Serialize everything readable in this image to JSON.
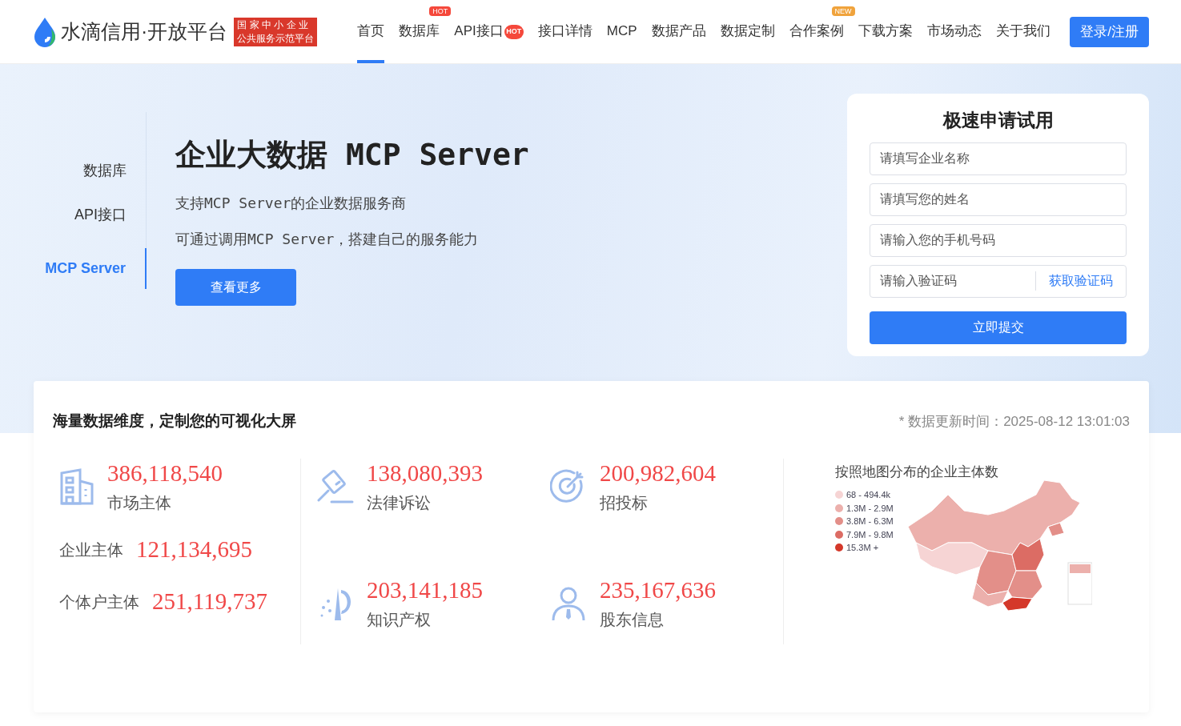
{
  "header": {
    "logo_text": "水滴信用·开放平台",
    "badge_lines": [
      "国 家 中 小 企 业",
      "公共服务示范平台"
    ],
    "nav": [
      {
        "label": "首页",
        "selected": true
      },
      {
        "label": "数据库",
        "selected": false,
        "tag": {
          "kind": "tab",
          "text": "HOT",
          "color": "#f5483b"
        }
      },
      {
        "label": "API接口",
        "selected": false,
        "tag": {
          "kind": "flame",
          "text": "HOT",
          "color": "#f5483b"
        }
      },
      {
        "label": "接口详情",
        "selected": false
      },
      {
        "label": "MCP",
        "selected": false
      },
      {
        "label": "数据产品",
        "selected": false
      },
      {
        "label": "数据定制",
        "selected": false
      },
      {
        "label": "合作案例",
        "selected": false,
        "tag": {
          "kind": "tab",
          "text": "NEW",
          "color": "#f0a33c"
        }
      },
      {
        "label": "下载方案",
        "selected": false
      },
      {
        "label": "市场动态",
        "selected": false
      },
      {
        "label": "关于我们",
        "selected": false
      }
    ],
    "login_button": "登录/注册"
  },
  "hero": {
    "side_tabs": [
      {
        "label": "数据库",
        "selected": false
      },
      {
        "label": "API接口",
        "selected": false
      },
      {
        "label": "MCP Server",
        "selected": true
      }
    ],
    "title": "企业大数据 MCP Server",
    "lines": [
      "支持MCP Server的企业数据服务商",
      "可通过调用MCP Server，搭建自己的服务能力"
    ],
    "more_button": "查看更多"
  },
  "trial_form": {
    "title": "极速申请试用",
    "fields": [
      {
        "placeholder": "请填写企业名称"
      },
      {
        "placeholder": "请填写您的姓名"
      },
      {
        "placeholder": "请输入您的手机号码"
      }
    ],
    "code_field": {
      "placeholder": "请输入验证码",
      "action": "获取验证码"
    },
    "submit": "立即提交"
  },
  "stats": {
    "title": "海量数据维度，定制您的可视化大屏",
    "update_label": "* 数据更新时间：",
    "update_time": "2025-08-12 13:01:03",
    "market": {
      "value": "386,118,540",
      "label": "市场主体",
      "sub": [
        {
          "label": "企业主体",
          "value": "121,134,695"
        },
        {
          "label": "个体户主体",
          "value": "251,119,737"
        }
      ]
    },
    "items": [
      {
        "kind": "law",
        "value": "138,080,393",
        "label": "法律诉讼"
      },
      {
        "kind": "bid",
        "value": "200,982,604",
        "label": "招投标"
      },
      {
        "kind": "ip",
        "value": "203,141,185",
        "label": "知识产权"
      },
      {
        "kind": "holder",
        "value": "235,167,636",
        "label": "股东信息"
      }
    ],
    "map": {
      "title": "按照地图分布的企业主体数",
      "legend": [
        {
          "label": "68 - 494.4k",
          "color": "#f6d4d4"
        },
        {
          "label": "1.3M - 2.9M",
          "color": "#ecb0ac"
        },
        {
          "label": "3.8M - 6.3M",
          "color": "#e38f89"
        },
        {
          "label": "7.9M - 9.8M",
          "color": "#dc6c64"
        },
        {
          "label": "15.3M +",
          "color": "#d4382a"
        }
      ]
    }
  }
}
